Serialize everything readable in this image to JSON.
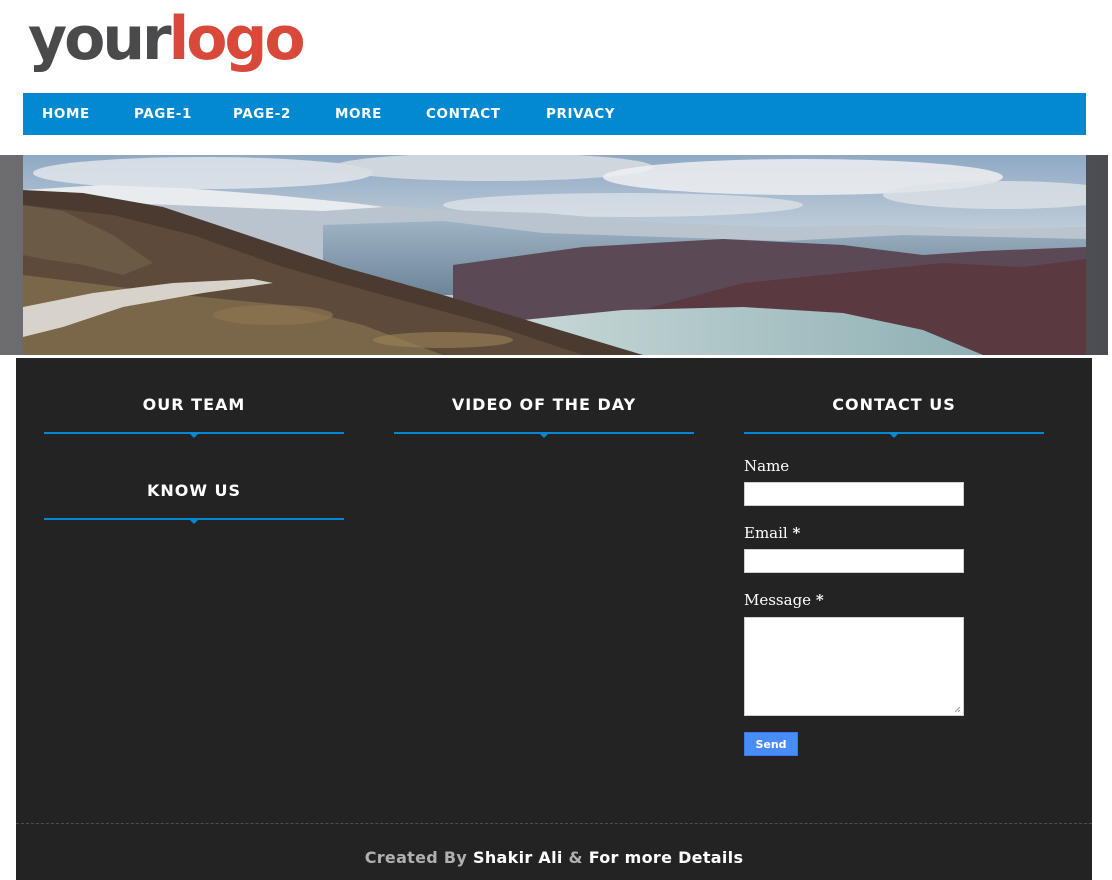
{
  "logo": {
    "word1": "your",
    "word2": "logo"
  },
  "nav": {
    "items": [
      "HOME",
      "PAGE-1",
      "PAGE-2",
      "MORE",
      "CONTACT",
      "PRIVACY"
    ]
  },
  "widgets": {
    "our_team": "OUR TEAM",
    "know_us": "KNOW US",
    "video": "VIDEO OF THE DAY",
    "contact": "CONTACT US"
  },
  "contact_form": {
    "name_label": "Name",
    "email_label": "Email",
    "message_label": "Message",
    "required_mark": "*",
    "name_value": "",
    "email_value": "",
    "message_value": "",
    "send_label": "Send"
  },
  "footer": {
    "created_by": "Created By",
    "author": "Shakir Ali",
    "amp": "&",
    "details": "For more Details"
  },
  "colors": {
    "nav_bg": "#0289d1",
    "logo_dark": "#4a4a4c",
    "logo_red": "#d9493a",
    "footer_bg": "#232323",
    "send_button": "#4a8cf7"
  }
}
